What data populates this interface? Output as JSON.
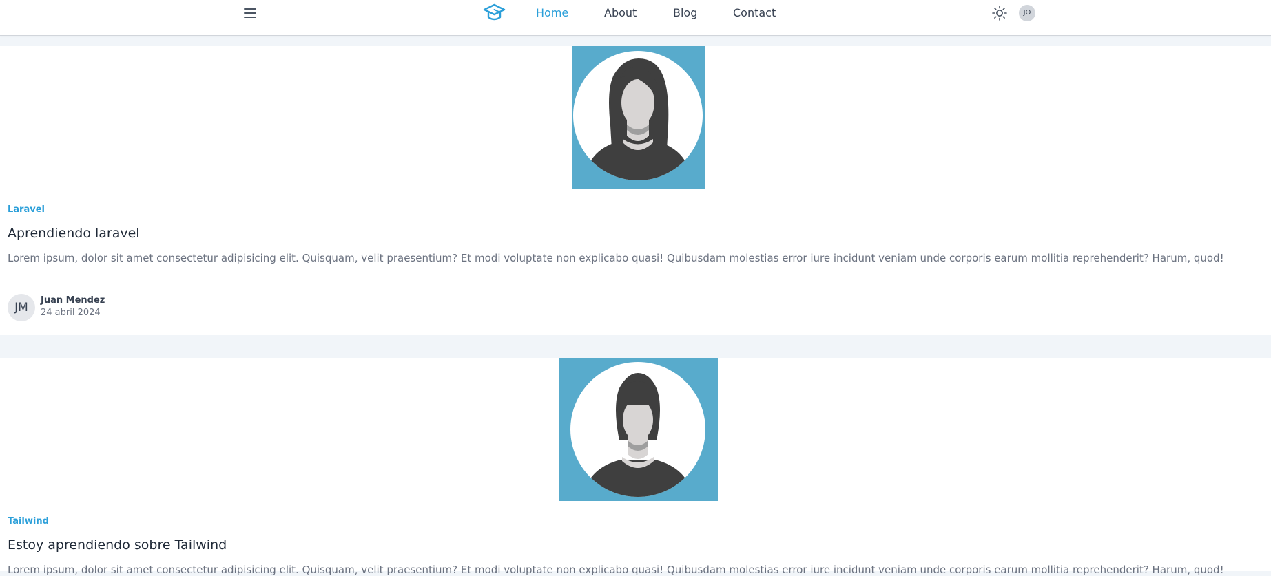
{
  "nav": {
    "links": [
      "Home",
      "About",
      "Blog",
      "Contact"
    ],
    "active": "Home",
    "user_initials": "JO",
    "accent_color": "#2b9fd9"
  },
  "posts": [
    {
      "category": "Laravel",
      "title": "Aprendiendo laravel",
      "excerpt": "Lorem ipsum, dolor sit amet consectetur adipisicing elit. Quisquam, velit praesentium? Et modi voluptate non explicabo quasi! Quibusdam molestias error iure incidunt veniam unde corporis earum mollitia reprehenderit? Harum, quod!",
      "author_initials": "JM",
      "author_name": "Juan Mendez",
      "date": "24 abril 2024",
      "image": "female-avatar-long-hair"
    },
    {
      "category": "Tailwind",
      "title": "Estoy aprendiendo sobre Tailwind",
      "excerpt": "Lorem ipsum, dolor sit amet consectetur adipisicing elit. Quisquam, velit praesentium? Et modi voluptate non explicabo quasi! Quibusdam molestias error iure incidunt veniam unde corporis earum mollitia reprehenderit? Harum, quod!",
      "image": "female-avatar-bob-hair"
    }
  ],
  "colors": {
    "image_bg": "#58abcc",
    "hair": "#3f3f3f",
    "skin": "#d8d5d4",
    "page_bg": "#f1f5f9"
  }
}
